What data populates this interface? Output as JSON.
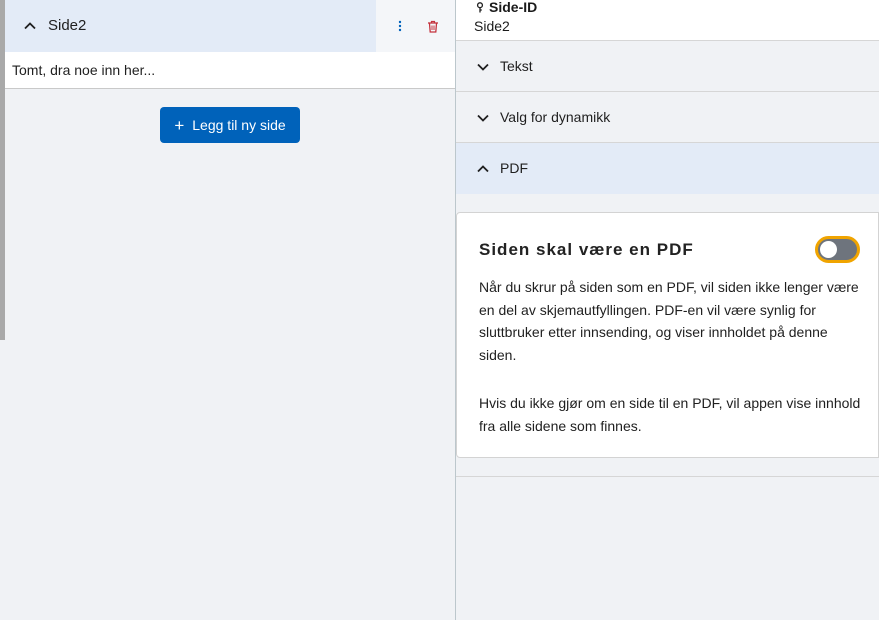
{
  "left": {
    "page_title": "Side2",
    "empty_message": "Tomt, dra noe inn her...",
    "add_page_label": "Legg til ny side",
    "icons": {
      "collapse": "chevron-up-icon",
      "menu": "kebab-menu-icon",
      "delete": "trash-icon",
      "add": "plus-icon"
    }
  },
  "right": {
    "page_id_label": "Side-ID",
    "page_id_value": "Side2",
    "sections": [
      {
        "label": "Tekst",
        "expanded": false
      },
      {
        "label": "Valg for dynamikk",
        "expanded": false
      },
      {
        "label": "PDF",
        "expanded": true
      }
    ],
    "pdf": {
      "heading": "Siden skal være en PDF",
      "toggle_on": false,
      "paragraph1": "Når du skrur på siden som en PDF, vil siden ikke lenger være en del av skjemautfyllingen. PDF-en vil være synlig for sluttbruker etter innsending, og viser innholdet på denne siden.",
      "paragraph2": "Hvis du ikke gjør om en side til en PDF, vil appen vise innhold fra alle sidene som finnes."
    }
  },
  "colors": {
    "primary_button": "#0062ba",
    "active_header": "#e3ebf7",
    "delete_icon": "#c4323d",
    "toggle_focus": "#f0a400",
    "toggle_track": "#6e747d"
  }
}
